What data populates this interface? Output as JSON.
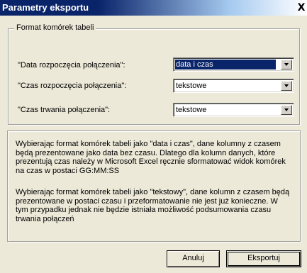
{
  "window": {
    "title": "Parametry eksportu",
    "close_label": "X"
  },
  "group": {
    "legend": "Format komórek tabeli",
    "fields": [
      {
        "label": "\"Data rozpoczęcia połączenia\":",
        "value": "data i czas"
      },
      {
        "label": "\"Czas rozpoczęcia połączenia\":",
        "value": "tekstowe"
      },
      {
        "label": "\"Czas trwania połączenia\":",
        "value": "tekstowe"
      }
    ]
  },
  "info": {
    "paragraphs": [
      "Wybierając format komórek tabeli jako \"data i czas\", dane kolumny z czasem będą prezentowane jako data bez czasu. Dlatego dla kolumn danych, które prezentują czas należy w Microsoft Excel ręcznie sformatować widok komórek na czas w postaci GG:MM:SS",
      "Wybierając format komórek tabeli jako \"tekstowy\", dane kolumn z czasem będą prezentowane w postaci czasu i przeformatowanie nie jest już konieczne. W tym przypadku jednak nie będzie istniała możliwość podsumowania czasu trwania połączeń"
    ]
  },
  "buttons": {
    "cancel": "Anuluj",
    "export": "Eksportuj"
  },
  "colors": {
    "titlebar_active": "#0a246a",
    "dialog_bg": "#ece9d8",
    "selection": "#0a246a"
  }
}
